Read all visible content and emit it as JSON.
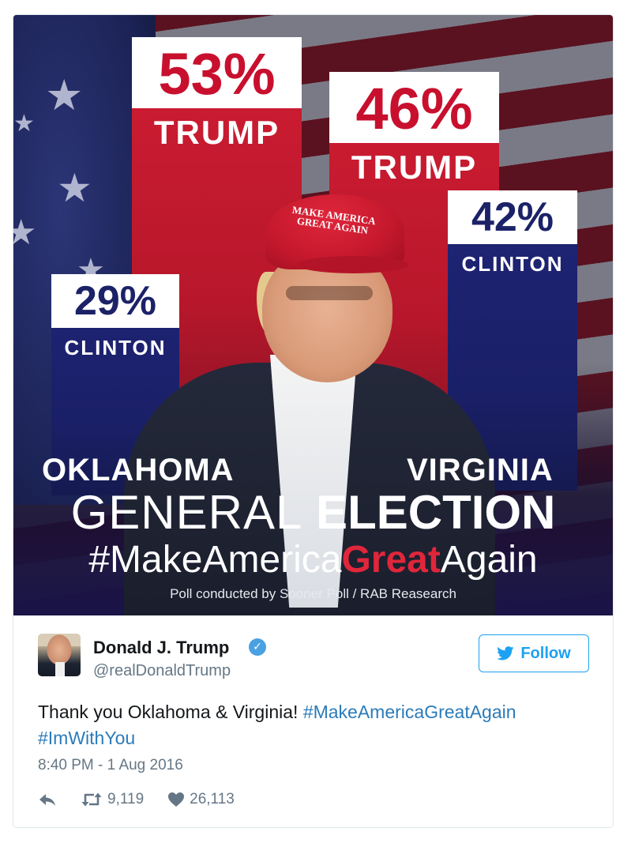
{
  "poster": {
    "oklahoma": {
      "trump_pct": "53%",
      "trump_label": "TRUMP",
      "clinton_pct": "29%",
      "clinton_label": "CLINTON",
      "state": "OKLAHOMA"
    },
    "virginia": {
      "trump_pct": "46%",
      "trump_label": "TRUMP",
      "clinton_pct": "42%",
      "clinton_label": "CLINTON",
      "state": "VIRGINIA"
    },
    "cap_text": "MAKE AMERICA GREAT AGAIN",
    "general_thin": "GENERAL",
    "general_bold": "ELECTION",
    "hashtag_pre": "#MakeAmerica",
    "hashtag_great": "Great",
    "hashtag_post": "Again",
    "poll_credit": "Poll conducted by Sooner Poll / RAB Reasearch",
    "colors": {
      "red": "#c8102e",
      "blue": "#1b2268"
    }
  },
  "tweet": {
    "display_name": "Donald J. Trump",
    "handle": "@realDonaldTrump",
    "follow_label": "Follow",
    "text_plain": "Thank you Oklahoma & Virginia! ",
    "hashtag_1": "#MakeAmericaGreatAgain",
    "hashtag_2": "#ImWithYou",
    "timestamp": "8:40 PM - 1 Aug 2016",
    "retweets": "9,119",
    "likes": "26,113",
    "colors": {
      "link": "#2b7bb9",
      "accent": "#1da1f2",
      "muted": "#657786"
    },
    "icons": [
      "reply-icon",
      "retweet-icon",
      "heart-icon",
      "verified-badge-icon",
      "twitter-bird-icon"
    ]
  }
}
